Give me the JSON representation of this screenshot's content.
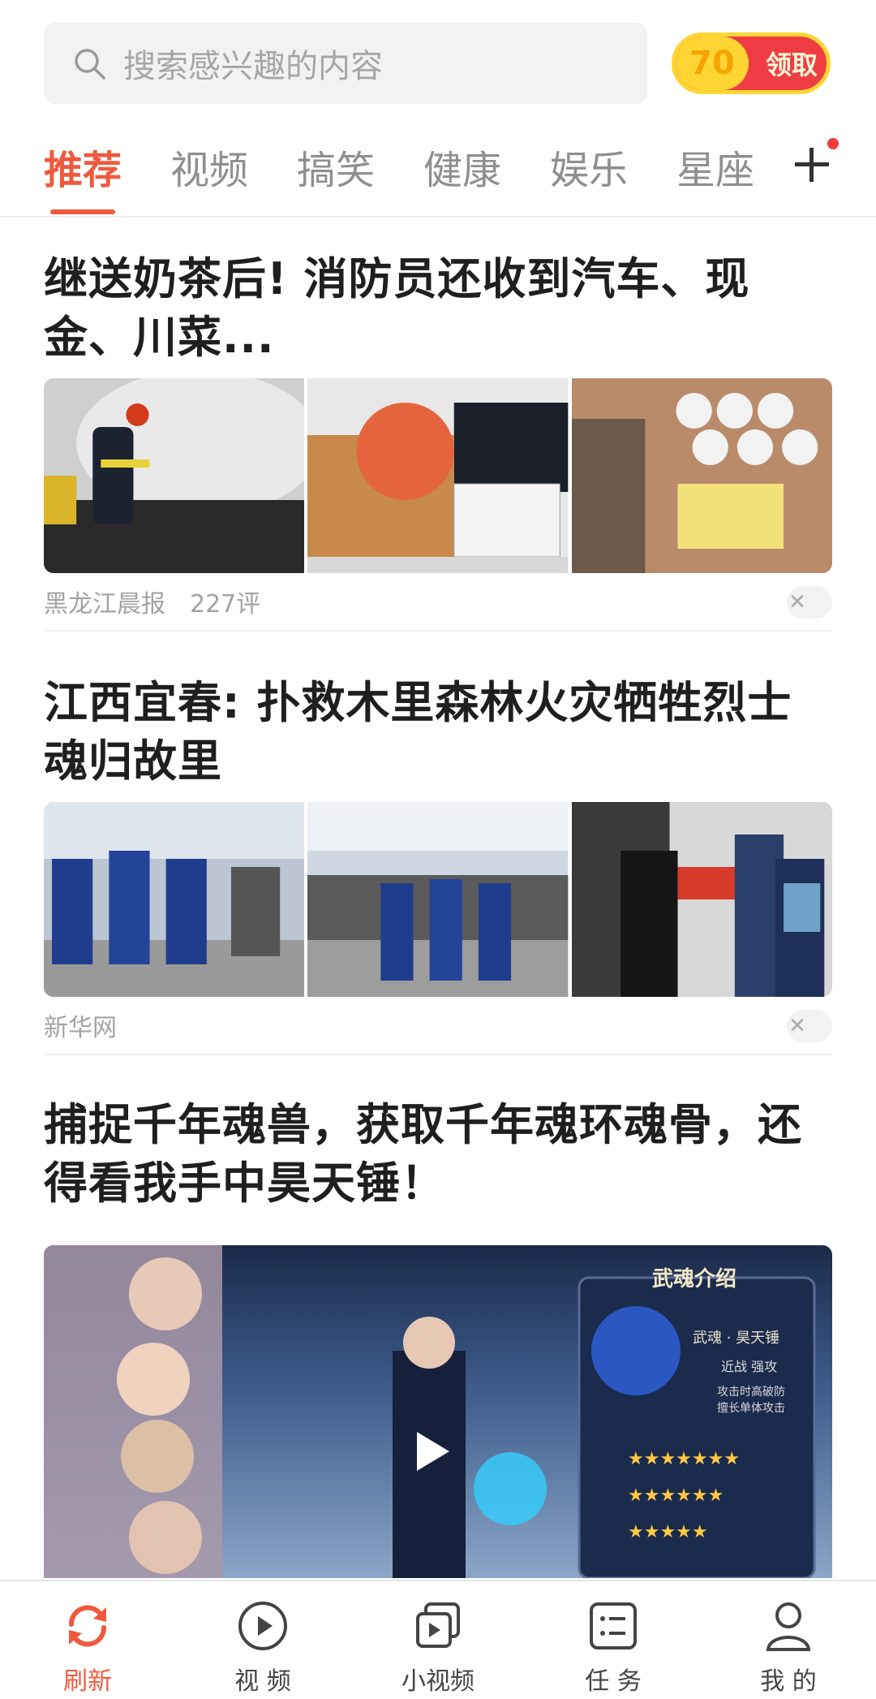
{
  "search": {
    "placeholder": "搜索感兴趣的内容"
  },
  "coin": {
    "value": "70",
    "label": "领取"
  },
  "tabs": [
    "推荐",
    "视频",
    "搞笑",
    "健康",
    "娱乐",
    "星座"
  ],
  "articles": [
    {
      "title": "继送奶茶后! 消防员还收到汽车、现金、川菜...",
      "source": "黑龙江晨报",
      "comments": "227评"
    },
    {
      "title": "江西宜春: 扑救木里森林火灾牺牲烈士魂归故里",
      "source": "新华网"
    },
    {
      "title": "捕捉千年魂兽，获取千年魂环魂骨，还得看我手中昊天锤！",
      "video_texts": {
        "panel_title": "武魂介绍",
        "name": "武魂 · 昊天锤",
        "attr": "近战 强攻",
        "desc1": "攻击时高破防",
        "desc2": "擅长单体攻击"
      }
    }
  ],
  "colors": {
    "accent": "#f0593e",
    "badge": "#f23b3b",
    "coin_yellow": "#ffd534",
    "coin_red": "#ef3d43"
  },
  "nav": [
    {
      "label": "刷新",
      "icon": "refresh-icon",
      "active": true
    },
    {
      "label": "视 频",
      "icon": "play-circle-icon"
    },
    {
      "label": "小视频",
      "icon": "stacked-play-icon"
    },
    {
      "label": "任 务",
      "icon": "task-list-icon"
    },
    {
      "label": "我 的",
      "icon": "user-icon"
    }
  ]
}
